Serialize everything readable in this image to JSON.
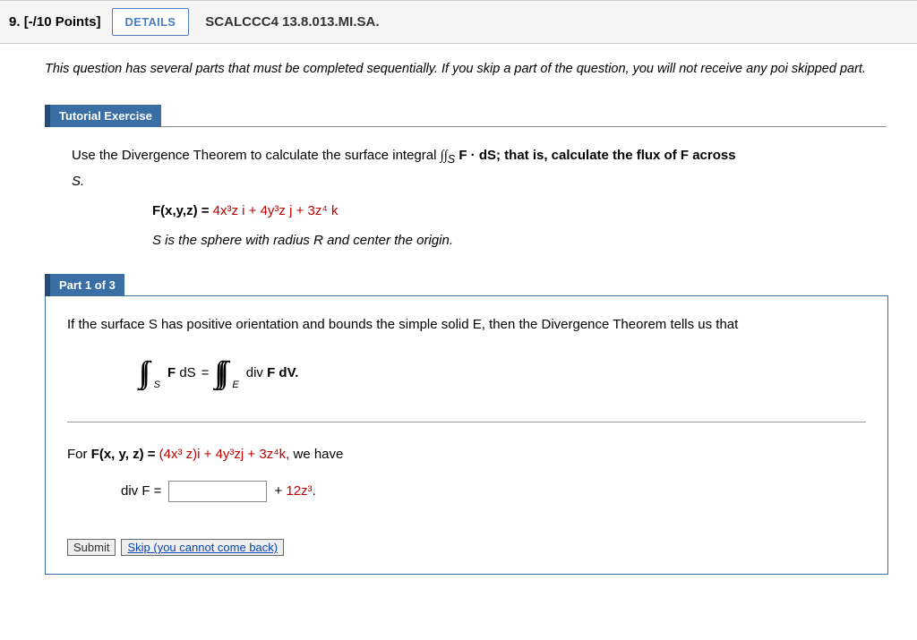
{
  "header": {
    "number": "9.",
    "points": "[-/10 Points]",
    "details_btn": "DETAILS",
    "assignment": "SCALCCC4 13.8.013.MI.SA."
  },
  "instruction": "This question has several parts that must be completed sequentially. If you skip a part of the question, you will not receive any poi\nskipped part.",
  "tutorial": {
    "title": "Tutorial Exercise",
    "intro_pre": "Use the Divergence Theorem to calculate the surface integral ",
    "intro_int": "∫∫",
    "intro_sub": "S",
    "intro_mid": " F · dS; that is, calculate the flux of F across",
    "intro_line2": "S.",
    "formula_label": "F(x,y,z) = ",
    "formula_body": "4x³z i + 4y³z j + 3z⁴ k",
    "sphere_desc": "S is the sphere with radius R and center the origin."
  },
  "part1": {
    "title": "Part 1 of 3",
    "text1": "If the surface S has positive orientation and bounds the simple solid E, then the Divergence Theorem tells us that",
    "eq_F": "F",
    "eq_dS": " dS",
    "eq_equals": " = ",
    "eq_div": "div ",
    "eq_Fdv": "F dV.",
    "text2_pre": "For  ",
    "text2_F": "F(x, y, z) = ",
    "text2_body": "(4x³ z)i + 4y³zj + 3z⁴k,",
    "text2_post": "  we have",
    "div_label": "div F  = ",
    "div_after": " + ",
    "div_red": "12z³",
    "div_period": "."
  },
  "buttons": {
    "submit": "Submit",
    "skip": "Skip (you cannot come back)"
  }
}
